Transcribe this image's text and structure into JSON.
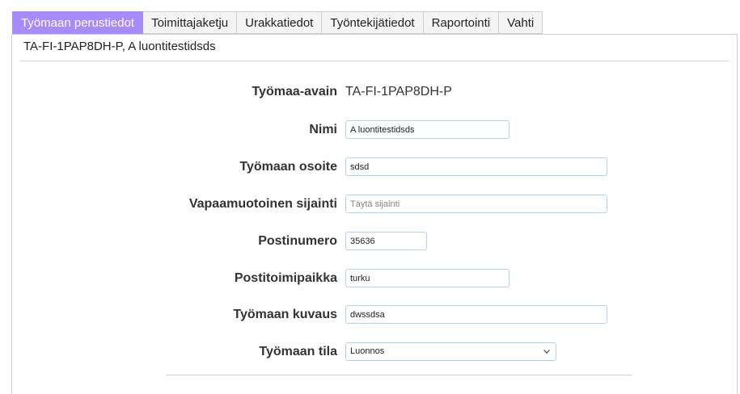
{
  "tabs": [
    {
      "label": "Työmaan perustiedot",
      "active": true
    },
    {
      "label": "Toimittajaketju",
      "active": false
    },
    {
      "label": "Urakkatiedot",
      "active": false
    },
    {
      "label": "Työntekijätiedot",
      "active": false
    },
    {
      "label": "Raportointi",
      "active": false
    },
    {
      "label": "Vahti",
      "active": false
    }
  ],
  "panel": {
    "title": "TA-FI-1PAP8DH-P, A luontitestidsds"
  },
  "form": {
    "key": {
      "label": "Työmaa-avain",
      "value": "TA-FI-1PAP8DH-P"
    },
    "name": {
      "label": "Nimi",
      "value": "A luontitestidsds"
    },
    "address": {
      "label": "Työmaan osoite",
      "value": "sdsd"
    },
    "location": {
      "label": "Vapaamuotoinen sijainti",
      "value": "",
      "placeholder": "Täytä sijainti"
    },
    "postal_code": {
      "label": "Postinumero",
      "value": "35636"
    },
    "city": {
      "label": "Postitoimipaikka",
      "value": "turku"
    },
    "description": {
      "label": "Työmaan kuvaus",
      "value": "dwssdsa"
    },
    "status": {
      "label": "Työmaan tila",
      "value": "Luonnos"
    }
  },
  "colors": {
    "active_tab": "#a78bfa",
    "input_border": "#b7d3e6"
  }
}
